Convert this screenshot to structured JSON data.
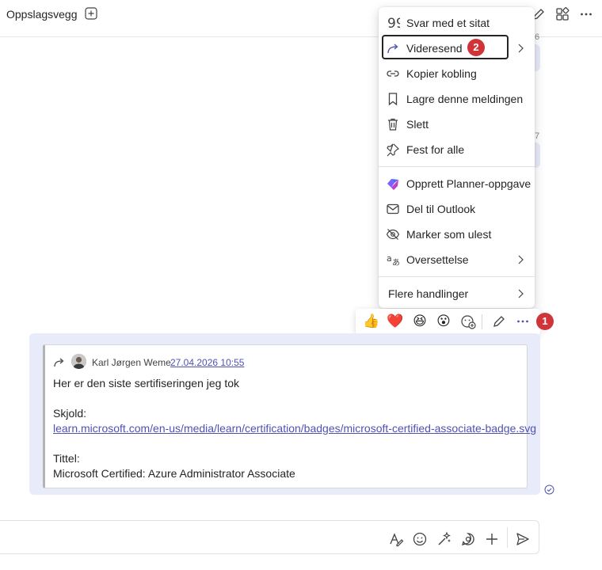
{
  "header": {
    "tab_title": "Oppslagsvegg",
    "icons": [
      "add-tab-icon",
      "compose-icon",
      "apps-icon",
      "more-icon"
    ]
  },
  "background": {
    "numbers": [
      "6",
      "7"
    ]
  },
  "context_menu": {
    "items": [
      {
        "label": "Svar med et sitat",
        "icon": "quote-icon"
      },
      {
        "label": "Videresend",
        "icon": "forward-icon",
        "has_submenu": true,
        "highlighted": true
      },
      {
        "label": "Kopier kobling",
        "icon": "link-icon"
      },
      {
        "label": "Lagre denne meldingen",
        "icon": "bookmark-icon"
      },
      {
        "label": "Slett",
        "icon": "trash-icon"
      },
      {
        "label": "Fest for alle",
        "icon": "pin-icon"
      },
      {
        "label": "Opprett Planner-oppgave",
        "icon": "planner-icon"
      },
      {
        "label": "Del til Outlook",
        "icon": "mail-icon"
      },
      {
        "label": "Marker som ulest",
        "icon": "unread-icon"
      },
      {
        "label": "Oversettelse",
        "icon": "translate-icon",
        "has_submenu": true
      },
      {
        "label": "Flere handlinger",
        "has_submenu": true
      }
    ]
  },
  "annotations": {
    "step1": "1",
    "step2": "2",
    "color": "#d13438"
  },
  "reaction_bar": {
    "reactions": [
      "👍",
      "❤️",
      "😆",
      "😮"
    ],
    "icons": [
      "add-reaction-icon",
      "edit-icon",
      "more-options-icon"
    ]
  },
  "message": {
    "author": "Karl Jørgen Weme",
    "timestamp": "27.04.2026 10:55",
    "line1": "Her er den siste sertifiseringen jeg tok",
    "label_shield": "Skjold:",
    "link": "learn.microsoft.com/en-us/media/learn/certification/badges/microsoft-certified-associate-badge.svg",
    "label_title": "Tittel:",
    "title_value": "Microsoft Certified: Azure Administrator Associate"
  },
  "compose": {
    "icons": [
      "format-icon",
      "emoji-icon",
      "copilot-icon",
      "loop-icon",
      "add-icon",
      "send-icon"
    ]
  },
  "colors": {
    "accent": "#4f52b2",
    "message_bg": "#e8ebfa",
    "badge": "#d13438"
  }
}
